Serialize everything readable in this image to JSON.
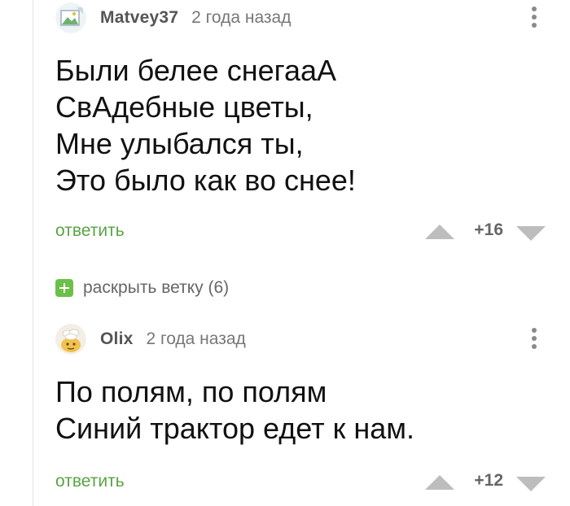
{
  "comments": [
    {
      "username": "Matvey37",
      "timestamp": "2 года назад",
      "lines": [
        "Были белее снегааА",
        "СвАдебные цветы,",
        "Мне улыбался ты,",
        "Это было как во снее!"
      ],
      "reply_label": "ответить",
      "rating": "+16",
      "avatar_icon": "broken-image-icon"
    },
    {
      "username": "Olix",
      "timestamp": "2 года назад",
      "lines": [
        "По полям, по полям",
        "Синий трактор едет к нам."
      ],
      "reply_label": "ответить",
      "rating": "+12",
      "avatar_icon": "cartoon-avatar-icon"
    }
  ],
  "expand_branch": {
    "label": "раскрыть ветку (6)",
    "icon": "plus-icon"
  },
  "colors": {
    "accent_green": "#5aa344",
    "plus_green": "#6cc04a",
    "muted_text": "#777777",
    "vote_arrow": "#bdbdbd"
  }
}
